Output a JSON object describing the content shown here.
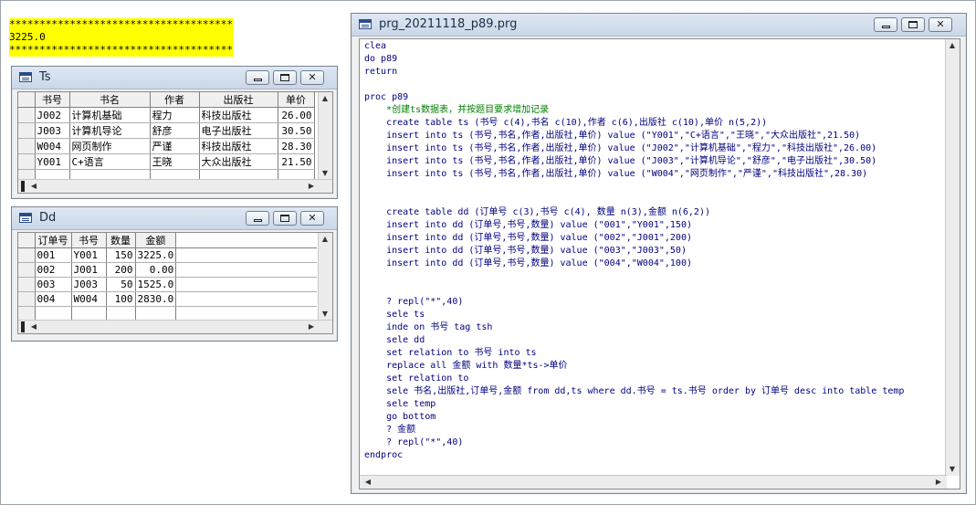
{
  "output": {
    "lines": [
      "****************************************",
      "3225.0",
      "****************************************"
    ]
  },
  "ts_window": {
    "title": "Ts",
    "columns": [
      "书号",
      "书名",
      "作者",
      "出版社",
      "单价"
    ],
    "rows": [
      [
        "J002",
        "计算机基础",
        "程力",
        "科技出版社",
        "26.00"
      ],
      [
        "J003",
        "计算机导论",
        "舒彦",
        "电子出版社",
        "30.50"
      ],
      [
        "W004",
        "网页制作",
        "严谨",
        "科技出版社",
        "28.30"
      ],
      [
        "Y001",
        "C+语言",
        "王晓",
        "大众出版社",
        "21.50"
      ]
    ]
  },
  "dd_window": {
    "title": "Dd",
    "columns": [
      "订单号",
      "书号",
      "数量",
      "金额"
    ],
    "rows": [
      [
        "001",
        "Y001",
        "150",
        "3225.0"
      ],
      [
        "002",
        "J001",
        "200",
        "0.00"
      ],
      [
        "003",
        "J003",
        "50",
        "1525.0"
      ],
      [
        "004",
        "W004",
        "100",
        "2830.0"
      ]
    ]
  },
  "editor_window": {
    "title": "prg_20211118_p89.prg",
    "lines": [
      "clea",
      "do p89",
      "return",
      "",
      "proc p89",
      "    *创建ts数据表，并按题目要求增加记录",
      "    create table ts (书号 c(4),书名 c(10),作者 c(6),出版社 c(10),单价 n(5,2))",
      "    insert into ts (书号,书名,作者,出版社,单价) value (\"Y001\",\"C+语言\",\"王晓\",\"大众出版社\",21.50)",
      "    insert into ts (书号,书名,作者,出版社,单价) value (\"J002\",\"计算机基础\",\"程力\",\"科技出版社\",26.00)",
      "    insert into ts (书号,书名,作者,出版社,单价) value (\"J003\",\"计算机导论\",\"舒彦\",\"电子出版社\",30.50)",
      "    insert into ts (书号,书名,作者,出版社,单价) value (\"W004\",\"网页制作\",\"严谨\",\"科技出版社\",28.30)",
      "",
      "",
      "    create table dd (订单号 c(3),书号 c(4), 数量 n(3),金额 n(6,2))",
      "    insert into dd (订单号,书号,数量) value (\"001\",\"Y001\",150)",
      "    insert into dd (订单号,书号,数量) value (\"002\",\"J001\",200)",
      "    insert into dd (订单号,书号,数量) value (\"003\",\"J003\",50)",
      "    insert into dd (订单号,书号,数量) value (\"004\",\"W004\",100)",
      "",
      "",
      "    ? repl(\"*\",40)",
      "    sele ts",
      "    inde on 书号 tag tsh",
      "    sele dd",
      "    set relation to 书号 into ts",
      "    replace all 金额 with 数量*ts->单价",
      "    set relation to",
      "    sele 书名,出版社,订单号,金额 from dd,ts where dd.书号 = ts.书号 order by 订单号 desc into table temp",
      "    sele temp",
      "    go bottom",
      "    ? 金额",
      "    ? repl(\"*\",40)",
      "endproc"
    ],
    "comment_line_index": 5
  },
  "colors": {
    "output_background": "#ffff00",
    "code_text": "#000080",
    "comment_text": "#008000"
  }
}
